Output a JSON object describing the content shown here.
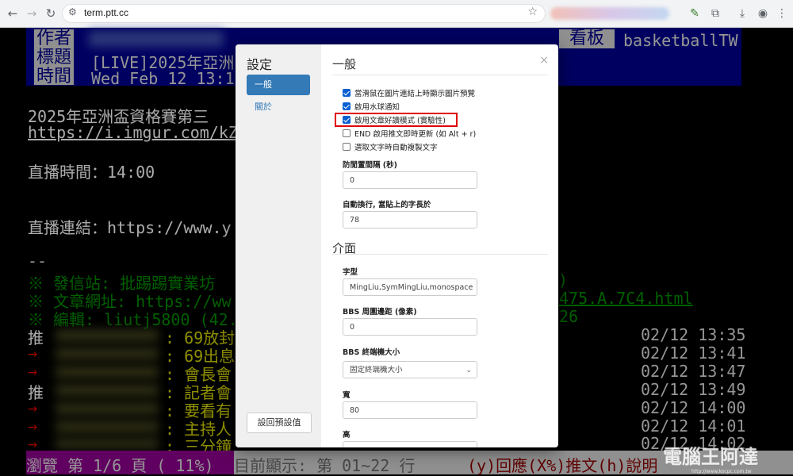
{
  "browser": {
    "url": "term.ptt.cc",
    "icons": [
      "back-icon",
      "forward-icon",
      "reload-icon",
      "site-settings-icon",
      "star-icon",
      "extensions-icon",
      "download-icon",
      "profile-icon",
      "menu-icon"
    ]
  },
  "terminal": {
    "header": {
      "author_label": "作者",
      "title_label": "標題",
      "time_label": "時間",
      "title_text": "[LIVE]2025年亞洲",
      "time_text": "Wed Feb 12 13:17",
      "board_label": "看板",
      "board_name": "basketballTW"
    },
    "body_lines": [
      {
        "text": "2025年亞洲盃資格賽第三",
        "color": "lwhite"
      },
      {
        "text": "https://i.imgur.com/kZa",
        "color": "lwhite"
      },
      {
        "text": "直播時間：14:00",
        "color": "lwhite"
      },
      {
        "text": "直播連結：https://www.y",
        "color": "lwhite"
      },
      {
        "text": "--",
        "color": "white"
      },
      {
        "text": "※ 發信站: 批踢踢實業坊",
        "color": "green"
      },
      {
        "text": "※ 文章網址: https://ww",
        "color": "green"
      },
      {
        "text": "※ 編輯: liutj5800 (42.",
        "color": "green"
      }
    ],
    "right_fragments": {
      "paren": ")",
      "url_tail": "475.A.7C4.html",
      "edit_tail": "26"
    },
    "pushes": [
      {
        "tag": "推",
        "text": ": 69放封",
        "time": "02/12 13:35"
      },
      {
        "tag": "→",
        "text": ": 69出息",
        "time": "02/12 13:41"
      },
      {
        "tag": "→",
        "text": ": 會長會",
        "time": "02/12 13:47"
      },
      {
        "tag": "推",
        "text": ": 記者會",
        "time": "02/12 13:49"
      },
      {
        "tag": "→",
        "text": ": 要看有",
        "time": "02/12 14:00"
      },
      {
        "tag": "→",
        "text": ": 主持人",
        "time": "02/12 14:01"
      },
      {
        "tag": "→",
        "text": ": 三分鐘",
        "time": "02/12 14:02"
      }
    ],
    "status": {
      "browse": " 瀏覽 第 1/6 頁 ( 11%)",
      "display": " 目前顯示: 第 01~22 行",
      "keys": "(y)回應(X%)推文(h)說明"
    }
  },
  "modal": {
    "title": "設定",
    "nav": [
      "一般",
      "關於"
    ],
    "reset_label": "設回預設值",
    "close": "×",
    "section_general": "一般",
    "checkboxes": [
      {
        "label": "當滑鼠在圖片連結上時顯示圖片預覽",
        "checked": true
      },
      {
        "label": "啟用水球通知",
        "checked": true
      },
      {
        "label": "啟用文章好讀模式 (實驗性)",
        "checked": true
      },
      {
        "label": "END 啟用推文即時更新 (如 Alt + r)",
        "checked": false
      },
      {
        "label": "選取文字時自動複製文字",
        "checked": false
      }
    ],
    "antiidle_label": "防閒置間隔 (秒)",
    "antiidle_value": "0",
    "autowrap_label": "自動換行, 當貼上的字長於",
    "autowrap_value": "78",
    "section_ui": "介面",
    "font_label": "字型",
    "font_value": "MingLiu,SymMingLiu,monospace",
    "padding_label": "BBS 周圍邊距 (像素)",
    "padding_value": "0",
    "termsize_label": "BBS 終端機大小",
    "termsize_value": "固定終端機大小",
    "width_label": "寬",
    "width_value": "80",
    "height_label": "高"
  },
  "watermark": {
    "text": "電腦王阿達",
    "url": "http://www.kocpc.com.tw"
  }
}
